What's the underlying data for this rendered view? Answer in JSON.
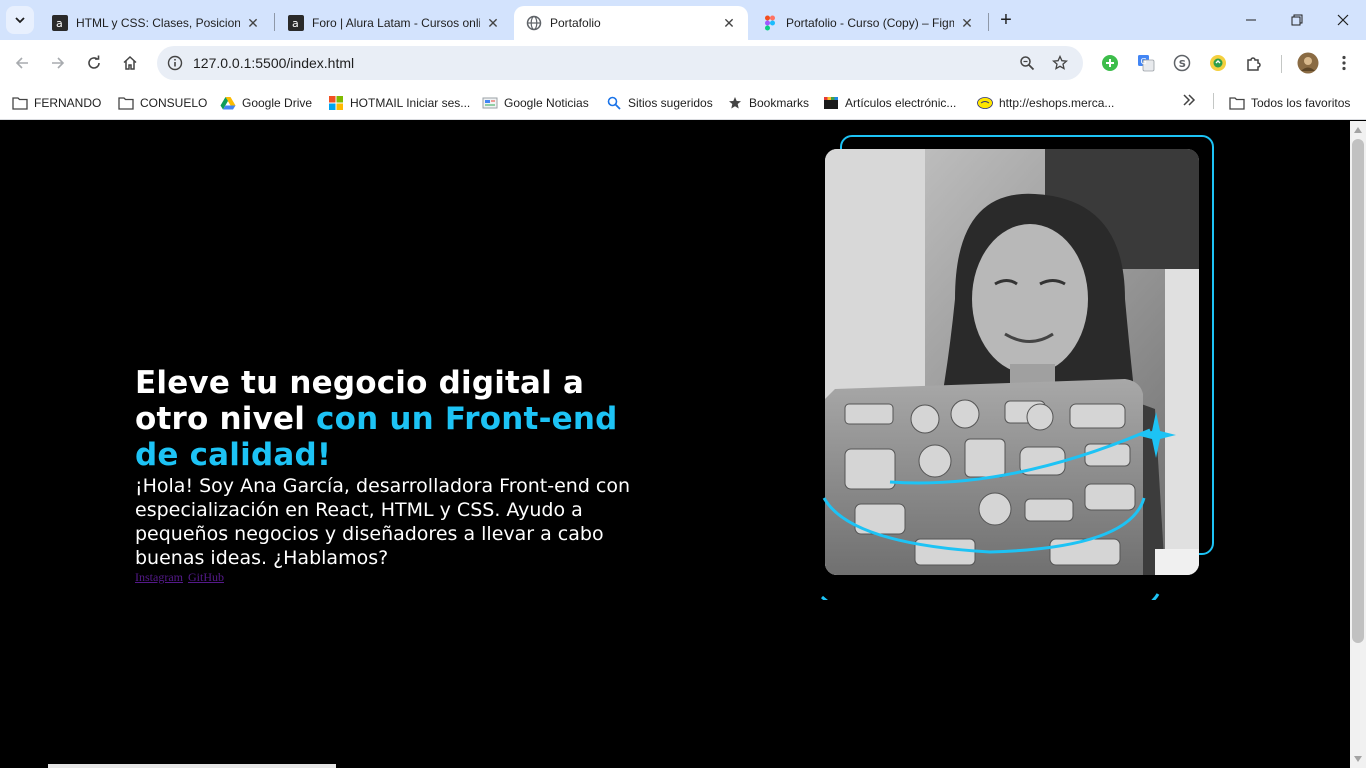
{
  "browser": {
    "tabs": [
      {
        "title": "HTML y CSS: Clases, Posicionamiento",
        "favicon": "alura-icon",
        "active": false
      },
      {
        "title": "Foro | Alura Latam - Cursos online",
        "favicon": "alura-icon",
        "active": false
      },
      {
        "title": "Portafolio",
        "favicon": "globe-icon",
        "active": true
      },
      {
        "title": "Portafolio - Curso (Copy) – Figma",
        "favicon": "figma-icon",
        "active": false
      }
    ],
    "address": {
      "url": "127.0.0.1:5500/index.html"
    },
    "bookmarks": [
      {
        "label": "FERNANDO",
        "icon": "folder-icon"
      },
      {
        "label": "CONSUELO",
        "icon": "folder-icon"
      },
      {
        "label": "Google Drive",
        "icon": "google-drive-icon"
      },
      {
        "label": "HOTMAIL Iniciar ses...",
        "icon": "microsoft-icon"
      },
      {
        "label": "Google Noticias",
        "icon": "news-icon"
      },
      {
        "label": "Sitios sugeridos",
        "icon": "search-icon"
      },
      {
        "label": "Bookmarks",
        "icon": "star-icon"
      },
      {
        "label": "Artículos electrónic...",
        "icon": "store-icon"
      },
      {
        "label": "http://eshops.merca...",
        "icon": "mercadolibre-icon"
      }
    ],
    "all_bookmarks_label": "Todos los favoritos"
  },
  "hero": {
    "title_part1": "Eleve tu negocio digital a otro nivel ",
    "title_accent": "con un Front-end de calidad!",
    "description": "¡Hola! Soy Ana García, desarrolladora Front-end con especialización en React, HTML y CSS. Ayudo a pequeños negocios y diseñadores a llevar a cabo buenas ideas. ¿Hablamos?",
    "links": {
      "instagram": "Instagram",
      "github": "GitHub"
    },
    "accent_color": "#1dc3f5"
  }
}
